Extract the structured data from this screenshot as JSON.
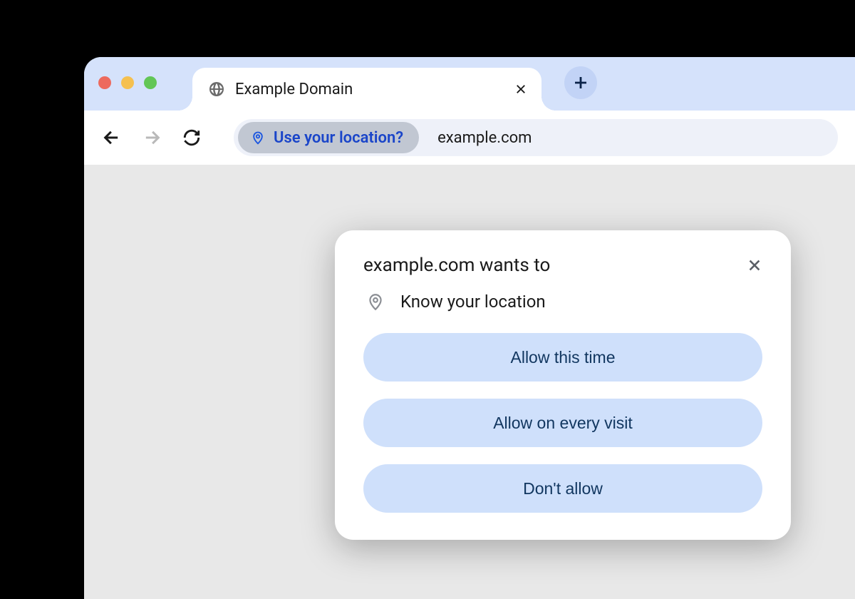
{
  "tab": {
    "title": "Example Domain"
  },
  "addressbar": {
    "chip_label": "Use your location?",
    "url": "example.com"
  },
  "popup": {
    "title": "example.com wants to",
    "permission": "Know your location",
    "buttons": {
      "allow_once": "Allow this time",
      "allow_always": "Allow on every visit",
      "deny": "Don't allow"
    }
  }
}
